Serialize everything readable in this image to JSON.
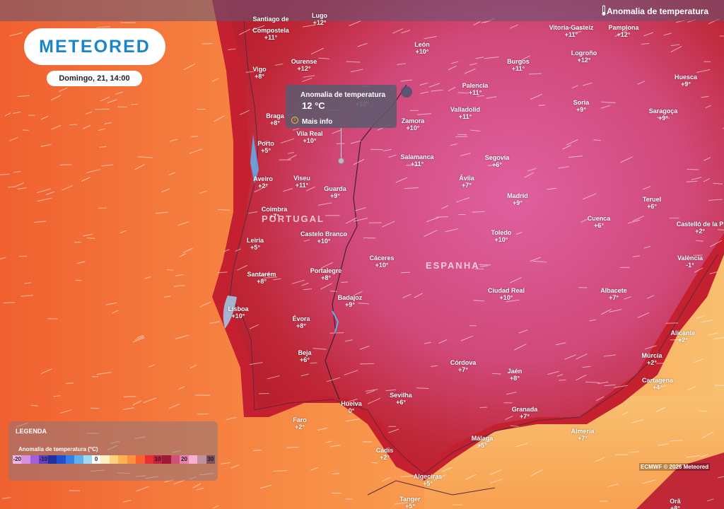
{
  "header": {
    "title": "Anomalia de temperatura",
    "icon": "thermometer-icon"
  },
  "brand": {
    "logo": "METEORED",
    "date": "Domingo, 21, 14:00"
  },
  "countries": [
    {
      "id": "portugal",
      "name": "PORTUGAL"
    },
    {
      "id": "espanha",
      "name": "ESPANHA"
    }
  ],
  "cities": [
    {
      "name": "Santiago de",
      "value": ""
    },
    {
      "name": "Compostela",
      "value": "+11°"
    },
    {
      "name": "Lugo",
      "value": "+12°"
    },
    {
      "name": "Vitoria-Gasteiz",
      "value": "+11°"
    },
    {
      "name": "Pamplona",
      "value": "+12°"
    },
    {
      "name": "León",
      "value": "+10°"
    },
    {
      "name": "Ourense",
      "value": "+12°"
    },
    {
      "name": "Burgos",
      "value": "+11°"
    },
    {
      "name": "Logroño",
      "value": "+12°"
    },
    {
      "name": "Vigo",
      "value": "+8°"
    },
    {
      "name": "Huesca",
      "value": "+9°"
    },
    {
      "name": "Palencia",
      "value": "+11°"
    },
    {
      "name": "Valladolid",
      "value": "+11°"
    },
    {
      "name": "Soria",
      "value": "+9°"
    },
    {
      "name": "Saragoça",
      "value": "+9°"
    },
    {
      "name": "Braga",
      "value": "+8°"
    },
    {
      "name": "Zamora",
      "value": "+10°"
    },
    {
      "name": "Vila Real",
      "value": "+10°"
    },
    {
      "name": "Porto",
      "value": "+5°"
    },
    {
      "name": "Salamanca",
      "value": "+11°"
    },
    {
      "name": "Segovia",
      "value": "+6°"
    },
    {
      "name": "Aveiro",
      "value": "+2°"
    },
    {
      "name": "Viseu",
      "value": "+11°"
    },
    {
      "name": "Guarda",
      "value": "+9°"
    },
    {
      "name": "Ávila",
      "value": "+7°"
    },
    {
      "name": "Madrid",
      "value": "+9°"
    },
    {
      "name": "Teruel",
      "value": "+6°"
    },
    {
      "name": "Coimbra",
      "value": "+7°"
    },
    {
      "name": "Cuenca",
      "value": "+6°"
    },
    {
      "name": "Castelló de la P",
      "value": "+2°"
    },
    {
      "name": "Leiria",
      "value": "+5°"
    },
    {
      "name": "Castelo Branco",
      "value": "+10°"
    },
    {
      "name": "Toledo",
      "value": "+10°"
    },
    {
      "name": "Cáceres",
      "value": "+10°"
    },
    {
      "name": "València",
      "value": "-1°"
    },
    {
      "name": "Santarém",
      "value": "+8°"
    },
    {
      "name": "Portalegre",
      "value": "+8°"
    },
    {
      "name": "Ciudad Real",
      "value": "+10°"
    },
    {
      "name": "Albacete",
      "value": "+7°"
    },
    {
      "name": "Badajoz",
      "value": "+9°"
    },
    {
      "name": "Lisboa",
      "value": "+10°"
    },
    {
      "name": "Évora",
      "value": "+8°"
    },
    {
      "name": "Alicante",
      "value": "+2°"
    },
    {
      "name": "Beja",
      "value": "+6°"
    },
    {
      "name": "Córdova",
      "value": "+7°"
    },
    {
      "name": "Jaén",
      "value": "+8°"
    },
    {
      "name": "Múrcia",
      "value": "+2°"
    },
    {
      "name": "Cartagena",
      "value": "+4°"
    },
    {
      "name": "Sevilha",
      "value": "+6°"
    },
    {
      "name": "Huelva",
      "value": "0°"
    },
    {
      "name": "Granada",
      "value": "+7°"
    },
    {
      "name": "Faro",
      "value": "+2°"
    },
    {
      "name": "Almería",
      "value": "+7°"
    },
    {
      "name": "Málaga",
      "value": "+5°"
    },
    {
      "name": "Cádis",
      "value": "+2°"
    },
    {
      "name": "Algeciras",
      "value": "+5°"
    },
    {
      "name": "Tanger",
      "value": "+5°"
    },
    {
      "name": "Orã",
      "value": "+8°"
    }
  ],
  "popup": {
    "title": "Anomalia de temperatura",
    "value": "12 °C",
    "more_label": "Mais info",
    "hidden_label": "+10°"
  },
  "legend": {
    "title": "LEGENDA",
    "subtitle": "Anomalia de temperatura (°C)",
    "ticks": [
      "-20",
      "-10",
      "0",
      "10",
      "20",
      "30"
    ],
    "colors": [
      "#f0b8e8",
      "#d890e0",
      "#a060d8",
      "#6040c0",
      "#2030a0",
      "#2050d0",
      "#3080e8",
      "#60b0f0",
      "#a0d8f8",
      "#ffffff",
      "#fff0c0",
      "#ffd080",
      "#ffb050",
      "#ff9040",
      "#f86030",
      "#e83030",
      "#c82040",
      "#a01838",
      "#d05078",
      "#e880b0",
      "#f8b0d0",
      "#c09098",
      "#805060"
    ]
  },
  "copyright": "ECMWF © 2026 Meteored"
}
